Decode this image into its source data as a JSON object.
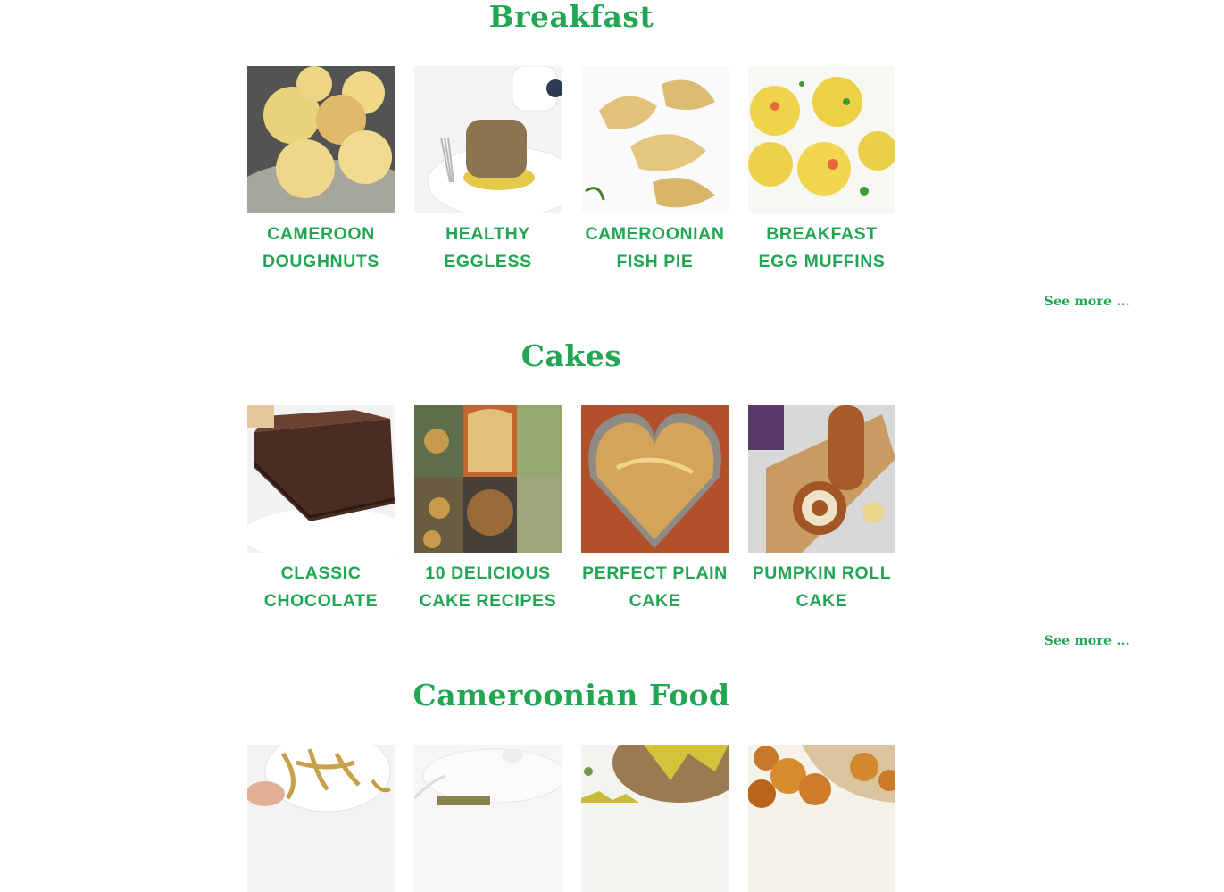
{
  "accent_color": "#22a654",
  "sections": [
    {
      "title": "Breakfast",
      "see_more": "See more ...",
      "recipes": [
        {
          "title": "Cameroon Doughnuts",
          "image": "doughnuts-photo"
        },
        {
          "title": "Healthy Eggless",
          "image": "pancakes-photo"
        },
        {
          "title": "Cameroonian Fish Pie",
          "image": "fish-pie-photo"
        },
        {
          "title": "Breakfast Egg Muffins",
          "image": "egg-muffins-photo"
        }
      ]
    },
    {
      "title": "Cakes",
      "see_more": "See more ...",
      "recipes": [
        {
          "title": "Classic Chocolate",
          "image": "chocolate-cake-photo"
        },
        {
          "title": "10 Delicious Cake Recipes",
          "image": "cake-collage-photo"
        },
        {
          "title": "Perfect Plain Cake",
          "image": "plain-cake-photo"
        },
        {
          "title": "Pumpkin Roll Cake",
          "image": "pumpkin-roll-photo"
        }
      ]
    },
    {
      "title": "Cameroonian Food",
      "recipes": [
        {
          "title": "",
          "image": "chin-chin-photo"
        },
        {
          "title": "",
          "image": "covered-dish-photo"
        },
        {
          "title": "",
          "image": "koki-photo"
        },
        {
          "title": "",
          "image": "puff-puff-photo"
        }
      ]
    }
  ]
}
